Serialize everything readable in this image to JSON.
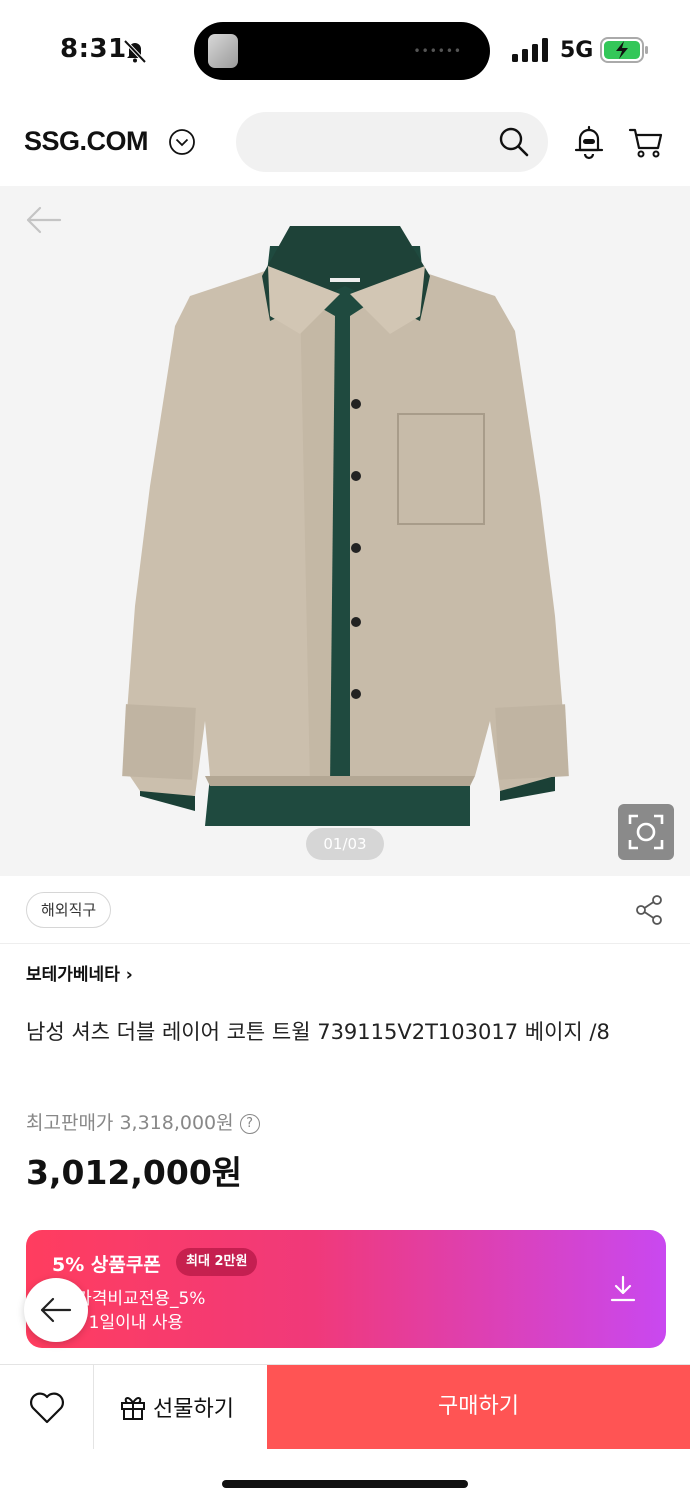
{
  "status_bar": {
    "time": "8:31",
    "network": "5G",
    "icons": [
      "bell-slash-icon",
      "signal-icon",
      "battery-charging-icon"
    ]
  },
  "header": {
    "logo": "SSG.COM",
    "search_placeholder": "",
    "icons": [
      "chevron-down-icon",
      "search-icon",
      "bell-icon",
      "cart-icon"
    ]
  },
  "gallery": {
    "counter": "01/03",
    "icons": [
      "back-arrow-icon",
      "lens-search-icon"
    ]
  },
  "product": {
    "tag": "해외직구",
    "brand": "보테가베네타 ›",
    "title": "남성 셔츠 더블 레이어 코튼 트윌 739115V2T103017 베이지 /8",
    "original_price_label": "최고판매가 3,318,000원",
    "original_price_help": "?",
    "sale_price": "3,012,000원"
  },
  "coupon": {
    "title": "5% 상품쿠폰",
    "limit_badge": "최대 2만원",
    "line1": "반_가격비교전용_5%",
    "line2": "로드 1일이내 사용",
    "colors": {
      "start": "#ff3d5f",
      "end": "#c948f0"
    }
  },
  "bottom_bar": {
    "gift_label": "선물하기",
    "buy_label": "구매하기",
    "buy_color": "#ff5454"
  }
}
